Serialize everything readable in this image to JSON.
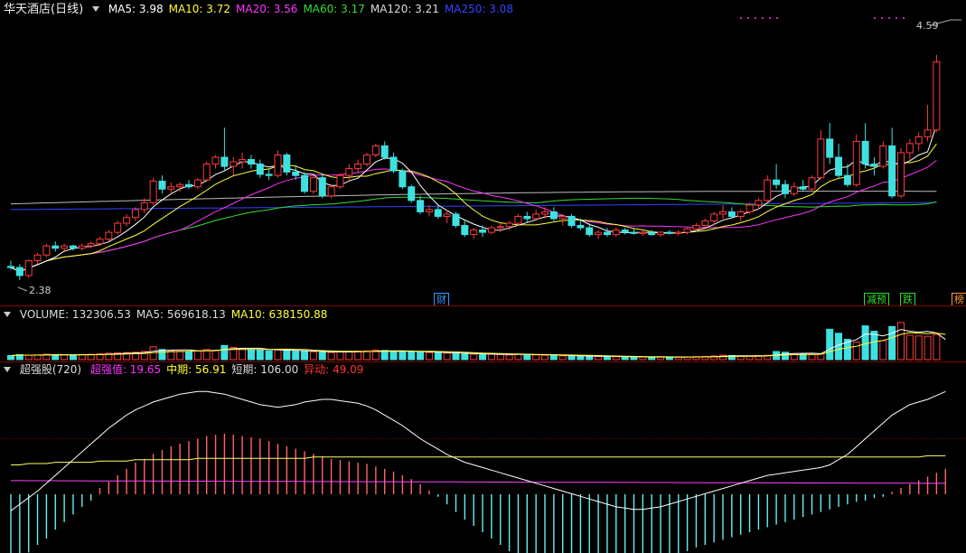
{
  "colors": {
    "up": "#ff3b3b",
    "down": "#3fe0e0",
    "ma5": "#ffffff",
    "ma10": "#ffff33",
    "ma20": "#ff33ff",
    "ma60": "#33dd33",
    "ma120": "#bbbbbb",
    "ma250": "#3344ff",
    "rsi_mid": "#ffff66",
    "rsi_low": "#ff44ff",
    "bar_up": "#ff6666",
    "bar_down": "#66eeee"
  },
  "price_panel": {
    "title": "华天酒店(日线)",
    "ma_readouts": [
      {
        "label": "MA5: 3.98",
        "color": "#ffffff"
      },
      {
        "label": "MA10: 3.72",
        "color": "#ffff33"
      },
      {
        "label": "MA20: 3.56",
        "color": "#ff33ff"
      },
      {
        "label": "MA60: 3.17",
        "color": "#33dd33"
      },
      {
        "label": "MA120: 3.21",
        "color": "#dddddd"
      },
      {
        "label": "MA250: 3.08",
        "color": "#3344ff"
      }
    ],
    "high_label": "4.59",
    "low_label": "2.38",
    "event_tags": [
      {
        "text": "财",
        "color": "#3399ff"
      },
      {
        "text": "减预",
        "color": "#33dd33"
      },
      {
        "text": "跌",
        "color": "#33dd33"
      },
      {
        "text": "榜",
        "color": "#ff9933"
      }
    ]
  },
  "volume_panel": {
    "readouts": [
      {
        "label": "VOLUME: 132306.53",
        "color": "#dddddd"
      },
      {
        "label": "MA5: 569618.13",
        "color": "#dddddd"
      },
      {
        "label": "MA10: 638150.88",
        "color": "#ffff33"
      }
    ]
  },
  "indicator_panel": {
    "title": "超强股(720)",
    "readouts": [
      {
        "label": "超强值: 19.65",
        "color": "#ff33ff"
      },
      {
        "label": "中期: 56.91",
        "color": "#ffff33"
      },
      {
        "label": "短期: 106.00",
        "color": "#dddddd"
      },
      {
        "label": "异动: 49.09",
        "color": "#ff3333"
      }
    ]
  },
  "chart_data": [
    {
      "type": "candlestick",
      "title": "华天酒店(日线)",
      "y_range_visible": [
        2.38,
        4.59
      ],
      "candles_ohlc": [
        [
          2.5,
          2.55,
          2.47,
          2.49
        ],
        [
          2.49,
          2.52,
          2.38,
          2.42
        ],
        [
          2.42,
          2.56,
          2.4,
          2.55
        ],
        [
          2.55,
          2.62,
          2.52,
          2.6
        ],
        [
          2.6,
          2.7,
          2.58,
          2.68
        ],
        [
          2.68,
          2.72,
          2.63,
          2.66
        ],
        [
          2.66,
          2.7,
          2.64,
          2.68
        ],
        [
          2.68,
          2.69,
          2.64,
          2.66
        ],
        [
          2.66,
          2.7,
          2.64,
          2.68
        ],
        [
          2.68,
          2.72,
          2.66,
          2.7
        ],
        [
          2.7,
          2.76,
          2.68,
          2.74
        ],
        [
          2.74,
          2.82,
          2.72,
          2.8
        ],
        [
          2.8,
          2.9,
          2.78,
          2.88
        ],
        [
          2.88,
          2.96,
          2.85,
          2.93
        ],
        [
          2.93,
          3.02,
          2.9,
          3.0
        ],
        [
          3.0,
          3.1,
          2.97,
          3.06
        ],
        [
          3.06,
          3.28,
          3.04,
          3.25
        ],
        [
          3.25,
          3.3,
          3.14,
          3.18
        ],
        [
          3.18,
          3.24,
          3.14,
          3.2
        ],
        [
          3.2,
          3.24,
          3.16,
          3.22
        ],
        [
          3.22,
          3.26,
          3.18,
          3.2
        ],
        [
          3.2,
          3.28,
          3.18,
          3.26
        ],
        [
          3.26,
          3.42,
          3.24,
          3.4
        ],
        [
          3.4,
          3.48,
          3.36,
          3.46
        ],
        [
          3.46,
          3.72,
          3.34,
          3.38
        ],
        [
          3.38,
          3.46,
          3.3,
          3.42
        ],
        [
          3.42,
          3.5,
          3.36,
          3.44
        ],
        [
          3.44,
          3.48,
          3.36,
          3.4
        ],
        [
          3.4,
          3.44,
          3.28,
          3.31
        ],
        [
          3.31,
          3.36,
          3.26,
          3.3
        ],
        [
          3.3,
          3.52,
          3.28,
          3.48
        ],
        [
          3.48,
          3.5,
          3.3,
          3.33
        ],
        [
          3.33,
          3.38,
          3.26,
          3.3
        ],
        [
          3.3,
          3.33,
          3.14,
          3.16
        ],
        [
          3.16,
          3.3,
          3.14,
          3.28
        ],
        [
          3.28,
          3.32,
          3.1,
          3.12
        ],
        [
          3.12,
          3.22,
          3.1,
          3.2
        ],
        [
          3.2,
          3.32,
          3.18,
          3.3
        ],
        [
          3.3,
          3.4,
          3.26,
          3.36
        ],
        [
          3.36,
          3.44,
          3.32,
          3.4
        ],
        [
          3.4,
          3.5,
          3.38,
          3.48
        ],
        [
          3.48,
          3.58,
          3.46,
          3.56
        ],
        [
          3.56,
          3.6,
          3.44,
          3.46
        ],
        [
          3.46,
          3.5,
          3.32,
          3.34
        ],
        [
          3.34,
          3.36,
          3.18,
          3.2
        ],
        [
          3.2,
          3.22,
          3.06,
          3.08
        ],
        [
          3.08,
          3.12,
          2.96,
          2.98
        ],
        [
          2.98,
          3.04,
          2.94,
          3.0
        ],
        [
          3.0,
          3.04,
          2.92,
          2.94
        ],
        [
          2.94,
          3.0,
          2.88,
          2.96
        ],
        [
          2.96,
          2.98,
          2.84,
          2.86
        ],
        [
          2.86,
          2.9,
          2.76,
          2.78
        ],
        [
          2.78,
          2.84,
          2.74,
          2.82
        ],
        [
          2.82,
          2.86,
          2.76,
          2.8
        ],
        [
          2.8,
          2.86,
          2.78,
          2.84
        ],
        [
          2.84,
          2.88,
          2.8,
          2.85
        ],
        [
          2.85,
          2.9,
          2.82,
          2.88
        ],
        [
          2.88,
          2.96,
          2.86,
          2.94
        ],
        [
          2.94,
          2.98,
          2.88,
          2.92
        ],
        [
          2.92,
          3.0,
          2.9,
          2.96
        ],
        [
          2.96,
          3.02,
          2.92,
          2.98
        ],
        [
          2.98,
          3.02,
          2.9,
          2.92
        ],
        [
          2.92,
          2.96,
          2.86,
          2.94
        ],
        [
          2.94,
          2.96,
          2.84,
          2.86
        ],
        [
          2.86,
          2.92,
          2.82,
          2.84
        ],
        [
          2.84,
          2.88,
          2.76,
          2.78
        ],
        [
          2.78,
          2.82,
          2.74,
          2.8
        ],
        [
          2.8,
          2.84,
          2.76,
          2.78
        ],
        [
          2.78,
          2.84,
          2.76,
          2.82
        ],
        [
          2.82,
          2.84,
          2.78,
          2.8
        ],
        [
          2.8,
          2.83,
          2.78,
          2.79
        ],
        [
          2.79,
          2.82,
          2.77,
          2.8
        ],
        [
          2.8,
          2.82,
          2.77,
          2.78
        ],
        [
          2.78,
          2.81,
          2.76,
          2.8
        ],
        [
          2.8,
          2.82,
          2.78,
          2.79
        ],
        [
          2.79,
          2.82,
          2.77,
          2.8
        ],
        [
          2.8,
          2.84,
          2.78,
          2.83
        ],
        [
          2.83,
          2.88,
          2.8,
          2.86
        ],
        [
          2.86,
          2.92,
          2.84,
          2.9
        ],
        [
          2.9,
          2.98,
          2.86,
          2.96
        ],
        [
          2.96,
          3.04,
          2.92,
          2.98
        ],
        [
          2.98,
          3.02,
          2.92,
          2.94
        ],
        [
          2.94,
          3.0,
          2.9,
          2.98
        ],
        [
          2.98,
          3.06,
          2.96,
          3.04
        ],
        [
          3.04,
          3.1,
          3.0,
          3.08
        ],
        [
          3.08,
          3.3,
          3.06,
          3.26
        ],
        [
          3.26,
          3.4,
          3.18,
          3.22
        ],
        [
          3.22,
          3.26,
          3.1,
          3.14
        ],
        [
          3.14,
          3.24,
          3.12,
          3.2
        ],
        [
          3.2,
          3.26,
          3.16,
          3.18
        ],
        [
          3.18,
          3.3,
          3.16,
          3.28
        ],
        [
          3.28,
          3.7,
          3.26,
          3.62
        ],
        [
          3.62,
          3.76,
          3.4,
          3.46
        ],
        [
          3.46,
          3.58,
          3.28,
          3.3
        ],
        [
          3.3,
          3.4,
          3.2,
          3.22
        ],
        [
          3.22,
          3.66,
          3.2,
          3.6
        ],
        [
          3.6,
          3.76,
          3.36,
          3.4
        ],
        [
          3.4,
          3.46,
          3.3,
          3.38
        ],
        [
          3.38,
          3.6,
          3.36,
          3.56
        ],
        [
          3.56,
          3.72,
          3.1,
          3.12
        ],
        [
          3.12,
          3.54,
          3.1,
          3.5
        ],
        [
          3.5,
          3.62,
          3.44,
          3.58
        ],
        [
          3.58,
          3.68,
          3.52,
          3.64
        ],
        [
          3.64,
          3.92,
          3.6,
          3.7
        ],
        [
          3.7,
          4.36,
          3.68,
          4.3
        ]
      ]
    },
    {
      "type": "bar",
      "title": "VOLUME",
      "series": [
        {
          "name": "VOLUME",
          "values": [
            120000,
            150000,
            130000,
            140000,
            160000,
            150000,
            140000,
            135000,
            150000,
            160000,
            170000,
            190000,
            200000,
            210000,
            220000,
            240000,
            380000,
            300000,
            260000,
            250000,
            240000,
            260000,
            300000,
            280000,
            420000,
            360000,
            320000,
            300000,
            280000,
            260000,
            300000,
            270000,
            250000,
            240000,
            230000,
            220000,
            210000,
            230000,
            240000,
            250000,
            260000,
            280000,
            270000,
            250000,
            240000,
            230000,
            220000,
            210000,
            200000,
            190000,
            180000,
            170000,
            160000,
            150000,
            160000,
            150000,
            140000,
            160000,
            150000,
            140000,
            130000,
            120000,
            110000,
            100000,
            105000,
            100000,
            90000,
            95000,
            85000,
            80000,
            75000,
            80000,
            78000,
            76000,
            74000,
            72000,
            80000,
            90000,
            95000,
            110000,
            130000,
            120000,
            110000,
            100000,
            120000,
            130000,
            240000,
            220000,
            180000,
            160000,
            150000,
            170000,
            900000,
            780000,
            600000,
            520000,
            1000000,
            840000,
            560000,
            980000,
            1100000,
            720000,
            700000,
            690000,
            740000,
            132306
          ]
        }
      ]
    },
    {
      "type": "bar",
      "title": "超强股(720)",
      "series": [
        {
          "name": "超强值",
          "values": [
            -55,
            -50,
            -46,
            -40,
            -35,
            -28,
            -22,
            -16,
            -10,
            -5,
            5,
            10,
            15,
            20,
            25,
            28,
            32,
            35,
            38,
            40,
            42,
            44,
            46,
            47,
            48,
            47,
            46,
            45,
            44,
            42,
            40,
            38,
            36,
            34,
            32,
            30,
            28,
            27,
            26,
            25,
            24,
            22,
            20,
            18,
            15,
            12,
            8,
            3,
            -2,
            -8,
            -14,
            -20,
            -25,
            -30,
            -35,
            -40,
            -45,
            -48,
            -50,
            -52,
            -54,
            -55,
            -56,
            -57,
            -58,
            -60,
            -61,
            -62,
            -62,
            -61,
            -60,
            -58,
            -55,
            -52,
            -50,
            -48,
            -45,
            -42,
            -40,
            -38,
            -36,
            -34,
            -32,
            -30,
            -28,
            -26,
            -24,
            -22,
            -20,
            -18,
            -16,
            -14,
            -12,
            -10,
            -8,
            -6,
            -5,
            -3,
            -2,
            2,
            5,
            8,
            11,
            14,
            17,
            20
          ]
        },
        {
          "name": "短期",
          "values": [
            15,
            20,
            25,
            30,
            36,
            42,
            48,
            54,
            60,
            66,
            72,
            78,
            83,
            88,
            92,
            95,
            98,
            100,
            102,
            104,
            105,
            106,
            106,
            105,
            104,
            102,
            100,
            98,
            96,
            95,
            94,
            95,
            96,
            98,
            99,
            100,
            100,
            99,
            98,
            97,
            95,
            92,
            88,
            84,
            80,
            75,
            70,
            66,
            62,
            58,
            55,
            52,
            50,
            48,
            46,
            44,
            42,
            40,
            38,
            36,
            34,
            32,
            30,
            28,
            26,
            24,
            22,
            20,
            18,
            17,
            16,
            16,
            17,
            18,
            20,
            22,
            24,
            26,
            28,
            30,
            32,
            34,
            36,
            38,
            40,
            42,
            43,
            44,
            45,
            46,
            47,
            48,
            50,
            54,
            58,
            64,
            70,
            76,
            82,
            88,
            92,
            96,
            98,
            100,
            103,
            106
          ]
        },
        {
          "name": "中期",
          "values": [
            50,
            50,
            51,
            51,
            51,
            52,
            52,
            52,
            52,
            52,
            53,
            53,
            53,
            53,
            54,
            54,
            54,
            54,
            54,
            54,
            54,
            55,
            55,
            55,
            55,
            55,
            55,
            55,
            55,
            55,
            55,
            55,
            55,
            55,
            56,
            56,
            56,
            56,
            56,
            56,
            56,
            56,
            56,
            56,
            56,
            56,
            56,
            56,
            56,
            56,
            56,
            56,
            56,
            56,
            56,
            56,
            56,
            56,
            56,
            56,
            56,
            56,
            56,
            56,
            56,
            56,
            56,
            56,
            56,
            56,
            56,
            56,
            56,
            56,
            56,
            56,
            56,
            56,
            56,
            56,
            56,
            56,
            56,
            56,
            56,
            56,
            56,
            56,
            56,
            56,
            56,
            56,
            56,
            56,
            56,
            56,
            56,
            56,
            56,
            56,
            56,
            56,
            56,
            57,
            57,
            57
          ]
        }
      ]
    }
  ]
}
